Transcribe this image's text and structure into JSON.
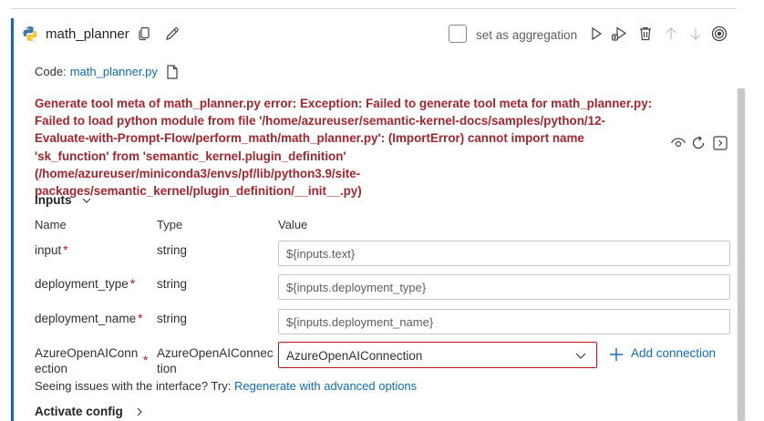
{
  "node": {
    "name": "math_planner",
    "aggregation_label": "set as aggregation",
    "aggregation_checked": false
  },
  "code": {
    "label": "Code:",
    "file": "math_planner.py"
  },
  "error": {
    "lines": [
      "Generate tool meta of math_planner.py error: Exception: Failed to generate tool meta for math_planner.py:",
      "Failed to load python module from file '/home/azureuser/semantic-kernel-docs/samples/python/12-",
      "Evaluate-with-Prompt-Flow/perform_math/math_planner.py': (ImportError) cannot import name",
      "'sk_function' from 'semantic_kernel.plugin_definition'",
      "(/home/azureuser/miniconda3/envs/pf/lib/python3.9/site-",
      "packages/semantic_kernel/plugin_definition/__init__.py)"
    ]
  },
  "inputs": {
    "title": "Inputs",
    "columns": {
      "name": "Name",
      "type": "Type",
      "value": "Value"
    },
    "rows": [
      {
        "name": "input",
        "required": "*",
        "type": "string",
        "value": "${inputs.text}"
      },
      {
        "name": "deployment_type",
        "required": "*",
        "type": "string",
        "value": "${inputs.deployment_type}"
      },
      {
        "name": "deployment_name",
        "required": "*",
        "type": "string",
        "value": "${inputs.deployment_name}"
      }
    ],
    "connection_row": {
      "name_line1": "AzureOpenAIConn",
      "name_line2": "ection",
      "required": "*",
      "type_line1": "AzureOpenAIConnec",
      "type_line2": "tion",
      "selected": "AzureOpenAIConnection",
      "add_label": "Add connection"
    }
  },
  "issues": {
    "text": "Seeing issues with the interface? Try:",
    "link": "Regenerate with advanced options"
  },
  "activate": {
    "title": "Activate config"
  },
  "colors": {
    "accent": "#0f6cbd",
    "error": "#a4262c",
    "required": "#c50f1f"
  }
}
